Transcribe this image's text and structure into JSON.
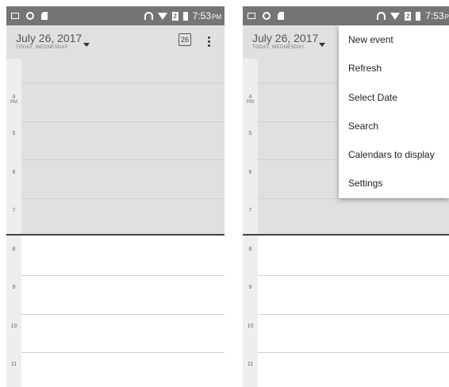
{
  "status_bar": {
    "time_left": "7:53",
    "ampm_left": "PM",
    "time_right": "7:53",
    "ampm_right": "P",
    "sim_label": "2"
  },
  "header": {
    "date": "July 26, 2017",
    "subtitle": "TODAY, WEDNESDAY",
    "today_day": "26"
  },
  "hours": [
    {
      "label": "4",
      "suffix": "PM"
    },
    {
      "label": "5",
      "suffix": ""
    },
    {
      "label": "6",
      "suffix": ""
    },
    {
      "label": "7",
      "suffix": ""
    },
    {
      "label": "8",
      "suffix": ""
    },
    {
      "label": "9",
      "suffix": ""
    },
    {
      "label": "10",
      "suffix": ""
    },
    {
      "label": "11",
      "suffix": ""
    }
  ],
  "menu": {
    "items": [
      "New event",
      "Refresh",
      "Select Date",
      "Search",
      "Calendars to display",
      "Settings"
    ]
  },
  "icons": {
    "status_left": [
      "message-icon",
      "circle-icon",
      "sd-card-icon"
    ],
    "status_right": [
      "headset-icon",
      "wifi-icon",
      "sim-icon",
      "battery-icon"
    ],
    "dropdown": "chevron-down-icon",
    "today": "calendar-today-icon",
    "overflow": "overflow-menu-icon"
  },
  "colors": {
    "status_bar": "#757575",
    "header": "#e0e0e0",
    "past_hours": "#e0e0e0",
    "now_line": "#424242"
  }
}
